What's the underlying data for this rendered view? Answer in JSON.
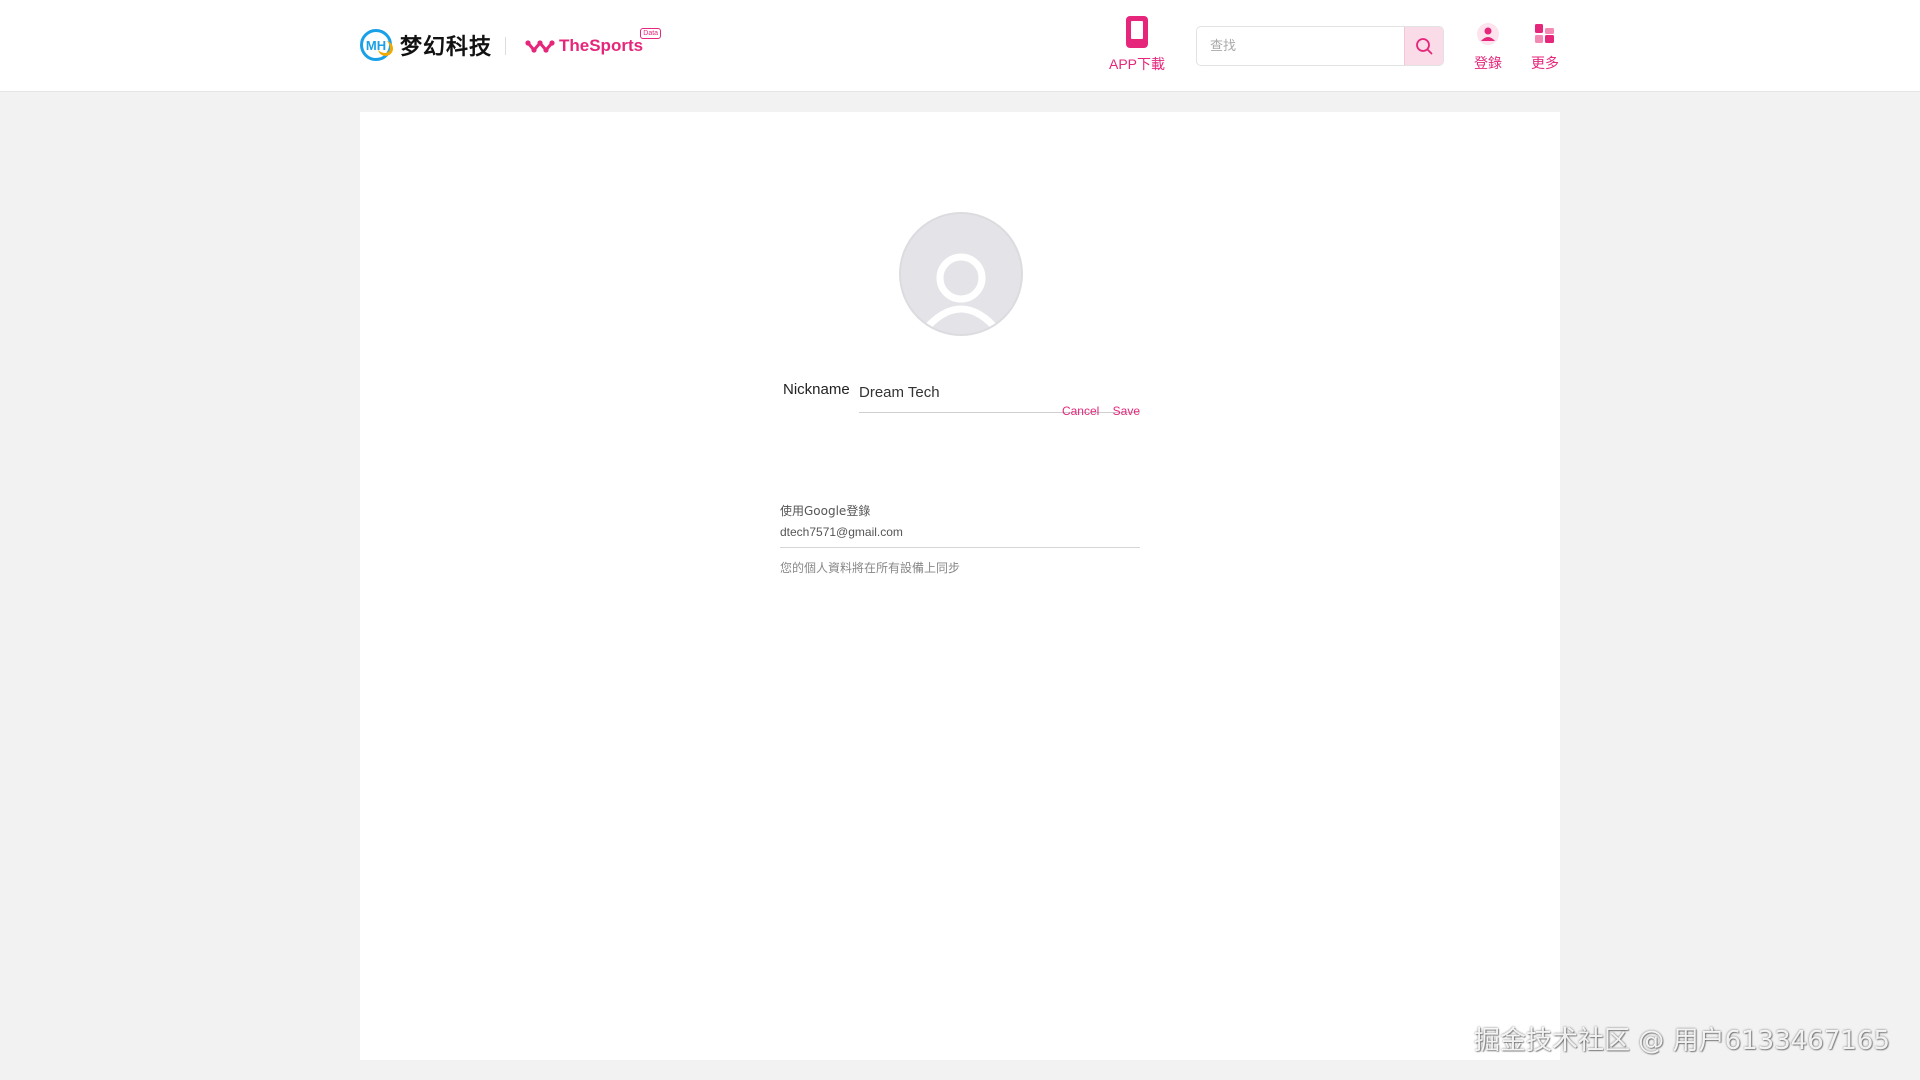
{
  "header": {
    "brand_name": "梦幻科技",
    "brand_mark": "MH",
    "partner_name": "TheSports",
    "partner_badge": "Data",
    "app_download_label": "APP下載",
    "search_placeholder": "查找",
    "login_label": "登錄",
    "more_label": "更多"
  },
  "profile": {
    "nickname_label": "Nickname",
    "nickname_value": "Dream Tech",
    "cancel_label": "Cancel",
    "save_label": "Save",
    "google_title": "使用Google登錄",
    "google_email": "dtech7571@gmail.com",
    "sync_note": "您的個人資料將在所有設備上同步"
  },
  "watermark": "掘金技术社区 @ 用户6133467165",
  "colors": {
    "accent": "#e5267b",
    "brand_blue": "#1aa0e6",
    "page_bg": "#f2f2f2"
  }
}
